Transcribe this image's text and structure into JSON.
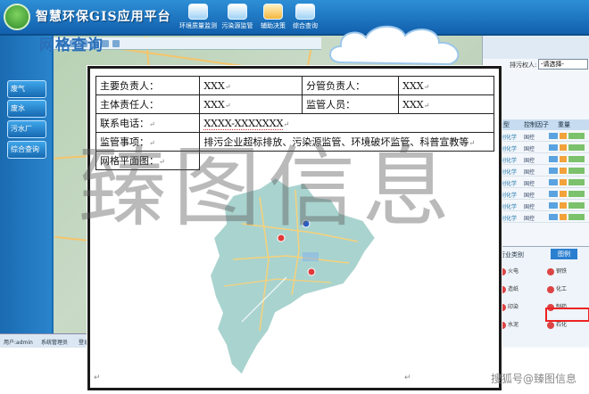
{
  "app": {
    "title": "智慧环保GIS应用平台",
    "nav": [
      "环境质量监测",
      "污染源监管",
      "辅助决策",
      "综合查询"
    ],
    "left_buttons": [
      "废气",
      "废水",
      "污水厂",
      "综合查询"
    ],
    "cloud_title": "网格查询",
    "right_panel": {
      "region_label": "排污权人:",
      "region_select": "-请选择-",
      "table_headers": [
        "类型",
        "控制因子",
        "重量"
      ],
      "rows": [
        {
          "type": "科创化学",
          "factor": "国控"
        },
        {
          "type": "科创化学",
          "factor": "国控"
        },
        {
          "type": "科创化学",
          "factor": "国控"
        },
        {
          "type": "科创化学",
          "factor": "国控"
        },
        {
          "type": "科创化学",
          "factor": "国控"
        },
        {
          "type": "科创化学",
          "factor": "国控"
        },
        {
          "type": "科创化学",
          "factor": "国控"
        },
        {
          "type": "科创化学",
          "factor": "国控"
        }
      ],
      "legend_tab1": "行业类别",
      "legend_tab2": "图例",
      "legend_items": [
        "火电",
        "钢铁",
        "造纸",
        "化工",
        "印染",
        "制药",
        "水泥",
        "石化"
      ]
    },
    "status": [
      "用户:admin",
      "系统管理员",
      "登录时间"
    ]
  },
  "table": {
    "rows": [
      {
        "l1": "主要负责人：",
        "v1": "XXX",
        "l2": "分管负责人：",
        "v2": "XXX"
      },
      {
        "l1": "主体责任人：",
        "v1": "XXX",
        "l2": "监管人员：",
        "v2": "XXX"
      }
    ],
    "phone_label": "联系电话：",
    "phone_value": "XXXX-XXXXXXX",
    "duty_label": "监管事项：",
    "duty_value": "排污企业超标排放、污染源监管、环境破坏监管、科普宣教等",
    "map_label": "网格平面图："
  },
  "watermark": "臻图信息",
  "credit": "搜狐号@臻图信息",
  "colors": {
    "district_fill": "#a9d3cf",
    "district_stroke": "#ffffff",
    "road": "#f6d27a",
    "app_blue": "#1b6db3"
  }
}
